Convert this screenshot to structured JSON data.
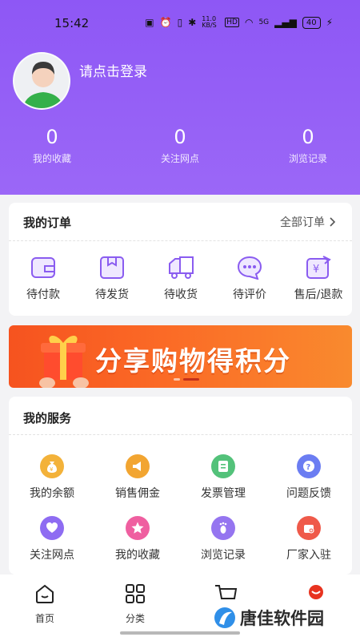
{
  "status_bar": {
    "time": "15:42",
    "network_speed": "11.0 KB/S",
    "signal": "5G",
    "battery": "40"
  },
  "profile": {
    "login_prompt": "请点击登录"
  },
  "stats": [
    {
      "value": "0",
      "label": "我的收藏"
    },
    {
      "value": "0",
      "label": "关注网点"
    },
    {
      "value": "0",
      "label": "浏览记录"
    }
  ],
  "orders": {
    "title": "我的订单",
    "all_label": "全部订单",
    "items": [
      {
        "label": "待付款",
        "icon": "wallet-icon"
      },
      {
        "label": "待发货",
        "icon": "package-icon"
      },
      {
        "label": "待收货",
        "icon": "truck-icon"
      },
      {
        "label": "待评价",
        "icon": "chat-bubble-icon"
      },
      {
        "label": "售后/退款",
        "icon": "refund-icon"
      }
    ]
  },
  "banner": {
    "text": "分享购物得积分"
  },
  "services": {
    "title": "我的服务",
    "items": [
      {
        "label": "我的余额",
        "icon": "money-bag-icon",
        "color": "#f3b23a"
      },
      {
        "label": "销售佣金",
        "icon": "megaphone-icon",
        "color": "#f2a531"
      },
      {
        "label": "发票管理",
        "icon": "invoice-icon",
        "color": "#53c27a"
      },
      {
        "label": "问题反馈",
        "icon": "question-icon",
        "color": "#6b7df2"
      },
      {
        "label": "关注网点",
        "icon": "heart-icon",
        "color": "#8e6cf2"
      },
      {
        "label": "我的收藏",
        "icon": "star-icon",
        "color": "#ef5fa0"
      },
      {
        "label": "浏览记录",
        "icon": "footprint-icon",
        "color": "#9575f0"
      },
      {
        "label": "厂家入驻",
        "icon": "store-icon",
        "color": "#ef5a4a"
      }
    ]
  },
  "tabbar": [
    {
      "label": "首页",
      "icon": "home-icon"
    },
    {
      "label": "分类",
      "icon": "grid-icon"
    },
    {
      "label": "",
      "icon": "cart-icon"
    },
    {
      "label": "",
      "icon": "profile-icon"
    }
  ],
  "watermark": {
    "text": "唐佳软件园"
  },
  "colors": {
    "accent": "#8e57f5",
    "order_icon": "#8a5cf0"
  }
}
